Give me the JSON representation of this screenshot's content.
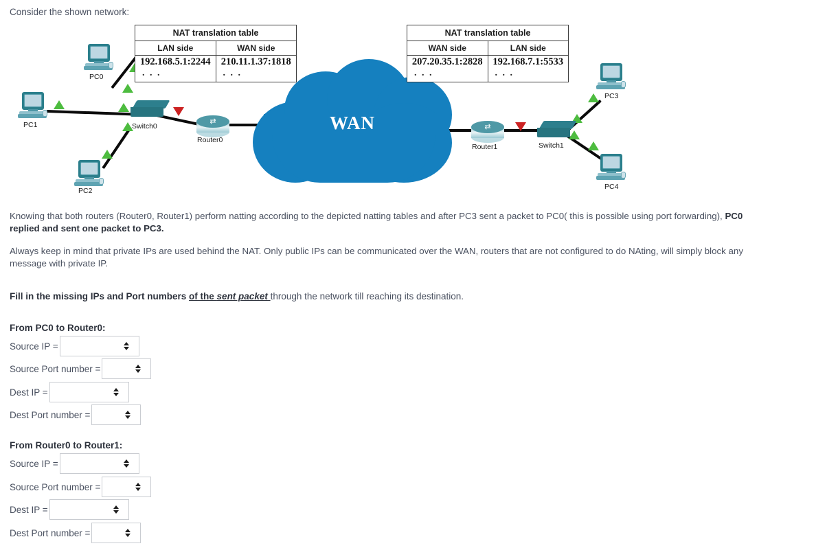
{
  "intro": "Consider the shown network:",
  "diagram": {
    "cloud_label": "WAN",
    "cloud_color": "#1580bf",
    "nodes": [
      {
        "id": "pc0",
        "label": "PC0"
      },
      {
        "id": "pc1",
        "label": "PC1"
      },
      {
        "id": "pc2",
        "label": "PC2"
      },
      {
        "id": "switch0",
        "label": "Switch0"
      },
      {
        "id": "router0",
        "label": "Router0"
      },
      {
        "id": "router1",
        "label": "Router1"
      },
      {
        "id": "switch1",
        "label": "Switch1"
      },
      {
        "id": "pc3",
        "label": "PC3"
      },
      {
        "id": "pc4",
        "label": "PC4"
      }
    ],
    "nat_table_left": {
      "title": "NAT translation table",
      "columns": [
        "LAN side",
        "WAN side"
      ],
      "rows": [
        [
          "192.168.5.1:2244",
          "210.11.1.37:1818"
        ],
        [
          ". . .",
          ". . ."
        ]
      ]
    },
    "nat_table_right": {
      "title": "NAT translation table",
      "columns": [
        "WAN side",
        "LAN side"
      ],
      "rows": [
        [
          "207.20.35.1:2828",
          "192.168.7.1:5533"
        ],
        [
          ". . .",
          ". . ."
        ]
      ]
    }
  },
  "paragraphs": {
    "p1_line1_a": "Knowing that both routers (Router0, Router1) perform natting according to the depicted natting tables and after PC3 sent a packet to PC0( this is possible using port forwarding), ",
    "p1_line1_b": "PC0",
    "p1_line2": "replied and sent one packet to PC3.",
    "p2_line1": "Always keep in mind that private IPs are used behind the NAT. Only public IPs can be communicated over the WAN, routers that are not configured to do NAting, will simply block any",
    "p2_line2": "message with private IP."
  },
  "fill_instruction": {
    "bold_lead": "Fill in the missing IPs and Port numbers ",
    "underlined": "of the ",
    "underlined_italic": "sent packet ",
    "tail": "through the network till reaching its destination."
  },
  "form": {
    "groups": [
      {
        "title": "From PC0 to Router0:",
        "fields": [
          {
            "label": "Source IP =",
            "value": "",
            "kind": "ip"
          },
          {
            "label": "Source Port number =",
            "value": "",
            "kind": "port"
          },
          {
            "label": "Dest IP =",
            "value": "",
            "kind": "ip"
          },
          {
            "label": "Dest Port number =",
            "value": "",
            "kind": "port"
          }
        ]
      },
      {
        "title": "From Router0 to Router1:",
        "fields": [
          {
            "label": "Source IP =",
            "value": "",
            "kind": "ip"
          },
          {
            "label": "Source Port number =",
            "value": "",
            "kind": "port"
          },
          {
            "label": "Dest IP =",
            "value": "",
            "kind": "ip"
          },
          {
            "label": "Dest Port number =",
            "value": "",
            "kind": "port"
          }
        ]
      }
    ]
  }
}
